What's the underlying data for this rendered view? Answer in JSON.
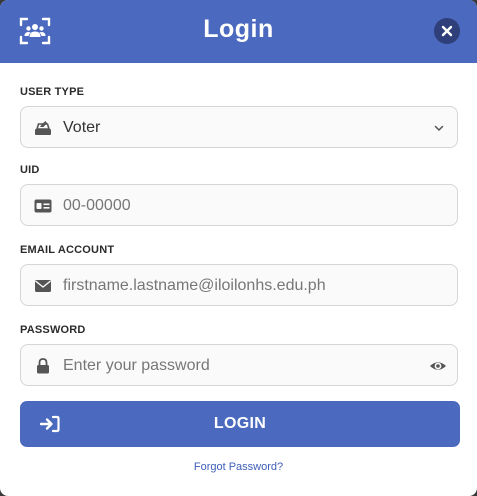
{
  "header": {
    "title": "Login",
    "logo_icon": "users-scan-icon",
    "close_icon": "close-icon",
    "color": "#4a69bf"
  },
  "form": {
    "user_type": {
      "label": "USER TYPE",
      "value": "Voter",
      "icon": "ballot-box-icon"
    },
    "uid": {
      "label": "UID",
      "placeholder": "00-00000",
      "icon": "id-card-icon"
    },
    "email": {
      "label": "EMAIL ACCOUNT",
      "placeholder": "firstname.lastname@iloilonhs.edu.ph",
      "icon": "envelope-icon"
    },
    "password": {
      "label": "PASSWORD",
      "placeholder": "Enter your password",
      "icon": "lock-icon",
      "toggle_icon": "eye-icon"
    }
  },
  "login_button": {
    "label": "LOGIN",
    "icon": "sign-in-icon"
  },
  "forgot_password": "Forgot Password?"
}
